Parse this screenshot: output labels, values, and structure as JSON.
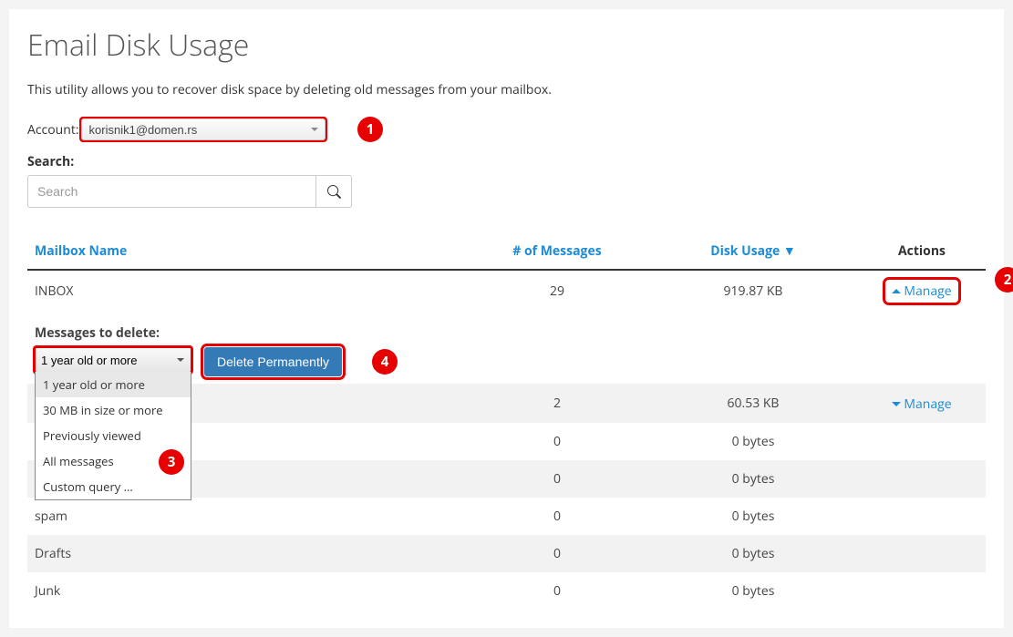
{
  "title": "Email Disk Usage",
  "intro": "This utility allows you to recover disk space by deleting old messages from your mailbox.",
  "account": {
    "label": "Account:",
    "selected": "korisnik1@domen.rs"
  },
  "search": {
    "label": "Search:",
    "placeholder": "Search"
  },
  "table": {
    "headers": {
      "name": "Mailbox Name",
      "count": "# of Messages",
      "disk": "Disk Usage ▼",
      "actions": "Actions"
    },
    "rows": [
      {
        "name": "INBOX",
        "count": "29",
        "disk": "919.87 KB",
        "manage": "Manage",
        "expanded": true
      },
      {
        "name": "",
        "count": "2",
        "disk": "60.53 KB",
        "manage": "Manage",
        "alt": true
      },
      {
        "name": "",
        "count": "0",
        "disk": "0 bytes"
      },
      {
        "name": "",
        "count": "0",
        "disk": "0 bytes",
        "alt": true
      },
      {
        "name": "spam",
        "count": "0",
        "disk": "0 bytes"
      },
      {
        "name": "Drafts",
        "count": "0",
        "disk": "0 bytes",
        "alt": true
      },
      {
        "name": "Junk",
        "count": "0",
        "disk": "0 bytes"
      }
    ]
  },
  "expanded": {
    "label": "Messages to delete:",
    "selected": "1 year old or more",
    "options": [
      "1 year old or more",
      "30 MB in size or more",
      "Previously viewed",
      "All messages",
      "Custom query …"
    ],
    "delete_label": "Delete Permanently"
  },
  "badges": {
    "b1": "1",
    "b2": "2",
    "b3": "3",
    "b4": "4"
  }
}
